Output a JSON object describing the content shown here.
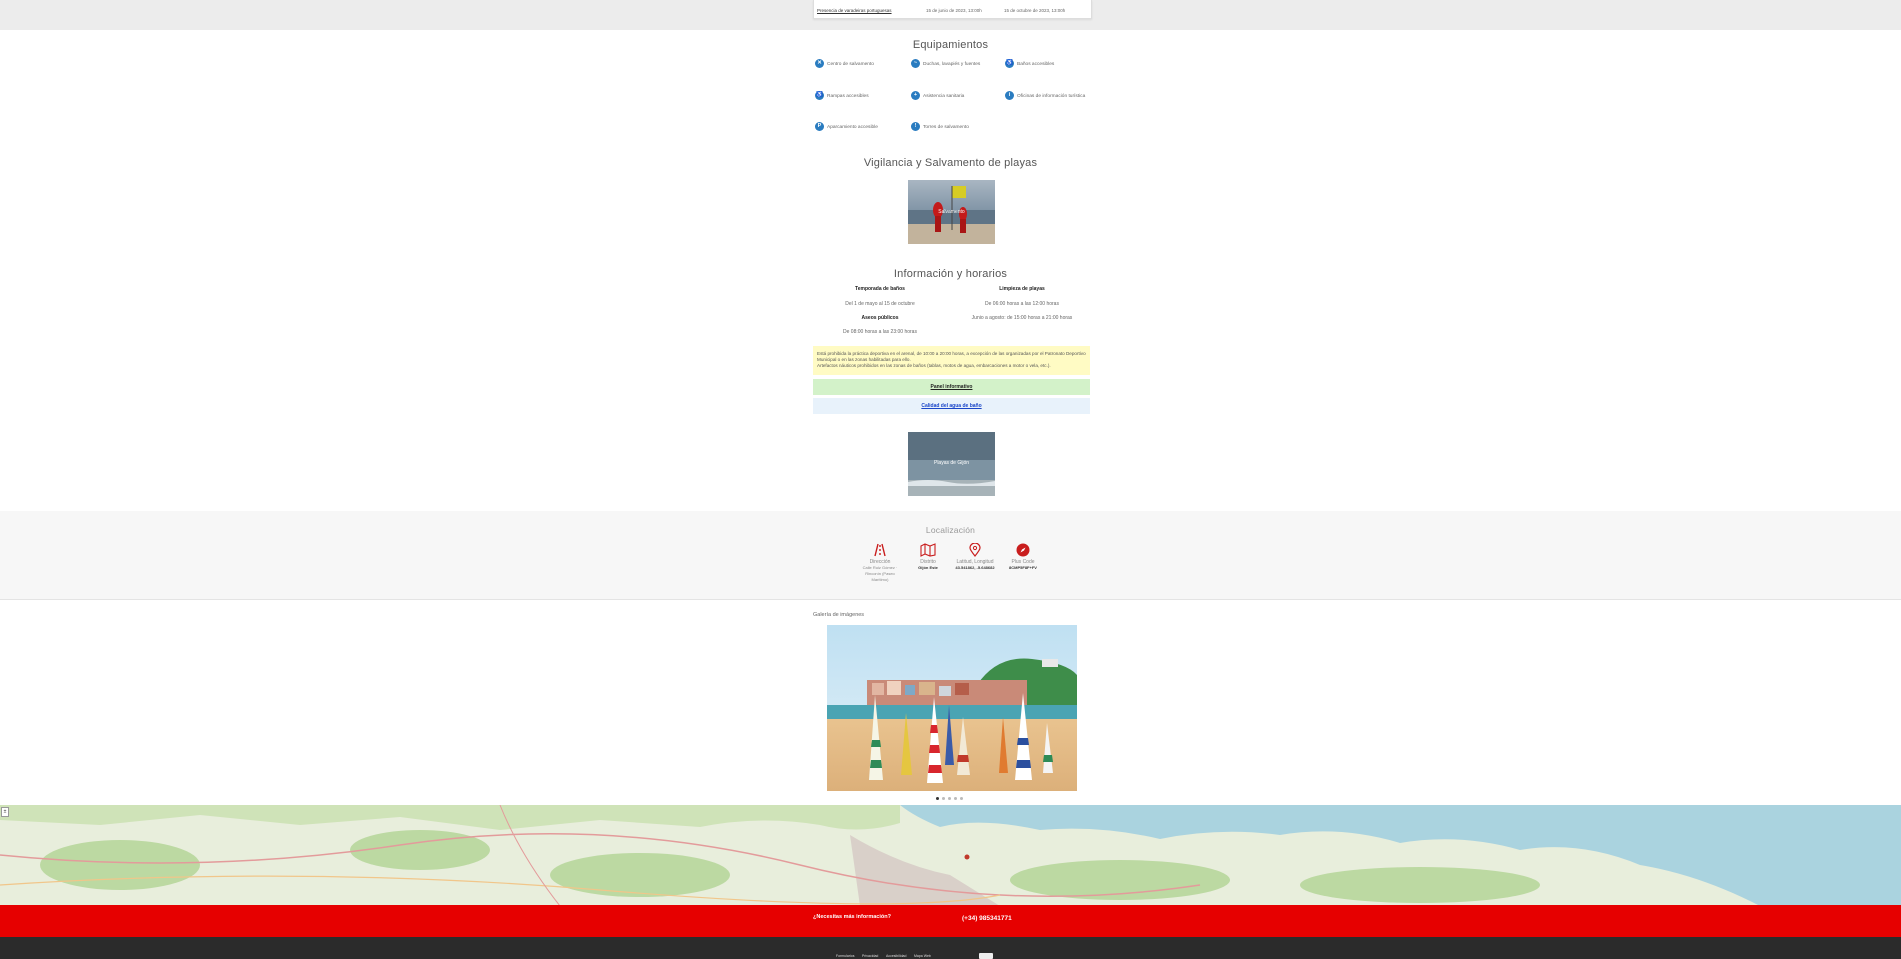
{
  "top_card": {
    "link": "Presencia de varadeiras portuguesas",
    "date_from": "15 de junio de 2023, 13:00h",
    "date_to": "15 de octubre de 2023, 13:00h"
  },
  "equipment": {
    "title": "Equipamientos",
    "items": [
      {
        "label": "Centro de salvamento",
        "icon": "lifebuoy-icon"
      },
      {
        "label": "Duchas, lavapiés y fuentes",
        "icon": "shower-icon"
      },
      {
        "label": "Baños accesibles",
        "icon": "accessible-bath-icon"
      },
      {
        "label": "Rampas accesibles",
        "icon": "ramp-icon"
      },
      {
        "label": "Asistencia sanitaria",
        "icon": "medical-cross-icon"
      },
      {
        "label": "Oficinas de información turística",
        "icon": "info-office-icon"
      },
      {
        "label": "Aparcamiento accesible",
        "icon": "parking-icon"
      },
      {
        "label": "Torres de salvamento",
        "icon": "tower-icon"
      }
    ]
  },
  "lifeguard": {
    "title": "Vigilancia y Salvamento de playas",
    "image_caption": "Salvamento"
  },
  "info": {
    "title": "Información y horarios",
    "season_label": "Temporada de baños",
    "season_value": "Del 1 de mayo al 15 de octubre",
    "toilets_label": "Aseos públicos",
    "toilets_value": "De 08:00 horas a las 23:00 horas",
    "cleaning_label": "Limpieza de playas",
    "cleaning_value1": "De 06:00 horas a las 12:00 horas",
    "cleaning_value2": "Junio a agosto: de 15:00 horas a 21:00 horas"
  },
  "notice": {
    "line1": "Está prohibida la práctica deportiva en el arenal, de 10:00 a 20:00 horas, a excepción de las organizadas por el Patronato Deportivo Municipal o en las zonas habilitadas para ello.",
    "line2": "Artefactos náuticos prohibidos en las zonas de baños (tablas, motos de agua, embarcaciones a motor o vela, etc.)."
  },
  "links": {
    "panel": "Panel informativo",
    "water_quality": "Calidad del agua de baño"
  },
  "beach_card": {
    "caption": "Playas de Gijón"
  },
  "location": {
    "title": "Localización",
    "items": [
      {
        "label": "Dirección",
        "value": "Calle Ruiz Gómez · Rinconín (Paseo Marítimo)",
        "icon": "road-icon"
      },
      {
        "label": "Distrito",
        "value": "Gijón Este",
        "icon": "map-icon"
      },
      {
        "label": "Latitud, Longitud",
        "value": "43.541862, -5.648682",
        "icon": "location-pin-icon"
      },
      {
        "label": "Plus Code",
        "value": "8CMP5F8F+FV",
        "icon": "compass-icon"
      }
    ]
  },
  "gallery": {
    "title": "Galería de imágenes",
    "slide_count": 5,
    "active_slide": 1
  },
  "contact": {
    "question": "¿Necesitas más información?",
    "phone": "(+34) 985341771"
  },
  "footer": {
    "links": [
      "Formularios",
      "Privacidad",
      "Accesibilidad",
      "Mapa Web"
    ]
  },
  "colors": {
    "brand_red": "#e60000",
    "icon_blue": "#2a7cc0",
    "notice_yellow": "#fffbc4",
    "panel_green": "#d3f2c9",
    "quality_blue": "#e8f2fb",
    "footer_dark": "#2b2b2b"
  }
}
